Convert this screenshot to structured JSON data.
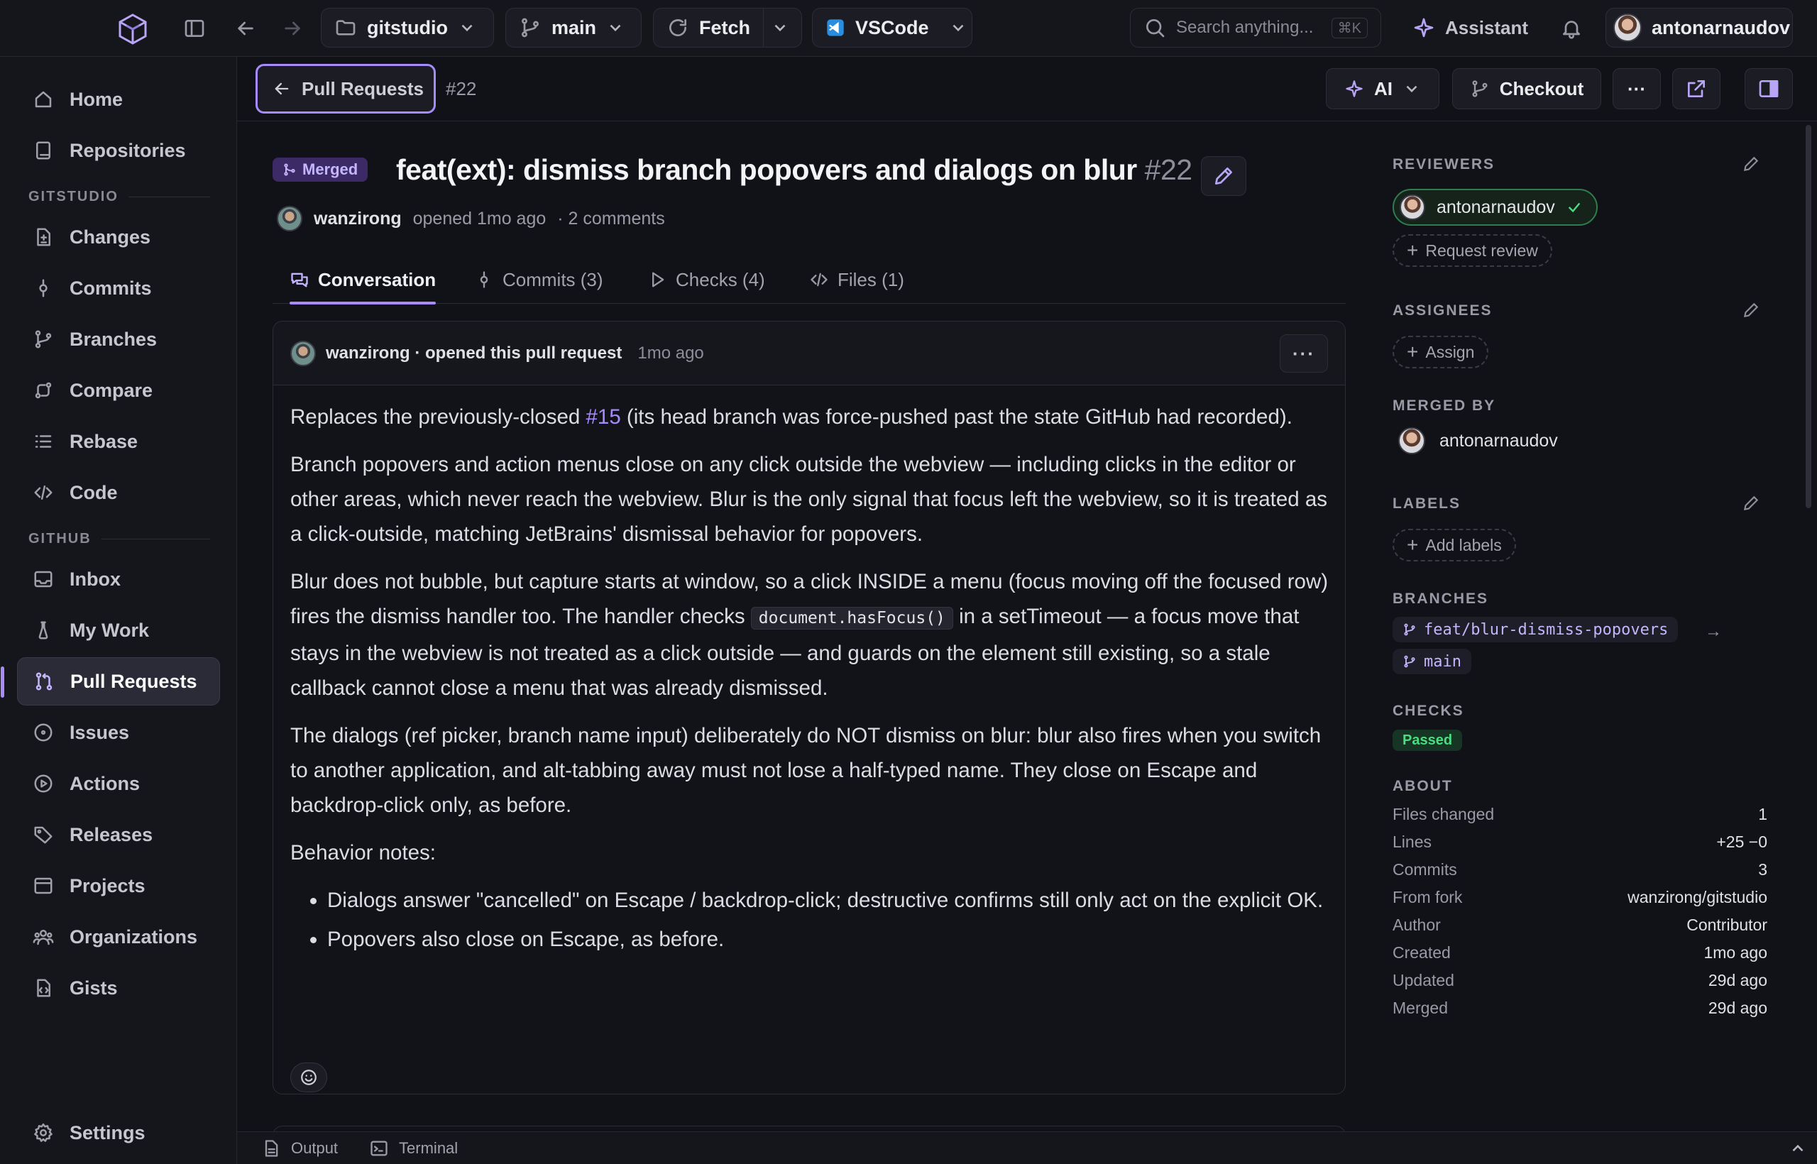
{
  "topbar": {
    "repo": "gitstudio",
    "branch": "main",
    "fetch_label": "Fetch",
    "editor_label": "VSCode",
    "search_placeholder": "Search anything...",
    "search_shortcut": "⌘K",
    "assistant_label": "Assistant",
    "username": "antonarnaudov"
  },
  "sidebar": {
    "top_items": [
      {
        "label": "Home",
        "icon": "home-icon"
      },
      {
        "label": "Repositories",
        "icon": "book-icon"
      }
    ],
    "section_gitstudio": "GITSTUDIO",
    "gitstudio_items": [
      {
        "label": "Changes",
        "icon": "diff-icon"
      },
      {
        "label": "Commits",
        "icon": "commit-icon"
      },
      {
        "label": "Branches",
        "icon": "branch-icon"
      },
      {
        "label": "Compare",
        "icon": "compare-icon"
      },
      {
        "label": "Rebase",
        "icon": "list-icon"
      },
      {
        "label": "Code",
        "icon": "code-icon"
      }
    ],
    "section_github": "GITHUB",
    "github_items": [
      {
        "label": "Inbox",
        "icon": "inbox-icon"
      },
      {
        "label": "My Work",
        "icon": "flask-icon"
      },
      {
        "label": "Pull Requests",
        "icon": "pull-request-icon",
        "active": true
      },
      {
        "label": "Issues",
        "icon": "issue-icon"
      },
      {
        "label": "Actions",
        "icon": "play-icon"
      },
      {
        "label": "Releases",
        "icon": "tag-icon"
      },
      {
        "label": "Projects",
        "icon": "project-icon"
      },
      {
        "label": "Organizations",
        "icon": "people-icon"
      },
      {
        "label": "Gists",
        "icon": "gist-icon"
      }
    ],
    "settings_label": "Settings"
  },
  "header": {
    "back_label": "Pull Requests",
    "pr_ref": "#22",
    "ai_label": "AI",
    "checkout_label": "Checkout",
    "more_label": "···"
  },
  "pr": {
    "status": "Merged",
    "title": "feat(ext): dismiss branch popovers and dialogs on blur",
    "number": "#22",
    "author": "wanzirong",
    "opened": "opened 1mo ago",
    "comments": "· 2 comments"
  },
  "tabs": [
    {
      "label": "Conversation",
      "icon": "comment-icon",
      "active": true
    },
    {
      "label": "Commits (3)",
      "icon": "commit-icon"
    },
    {
      "label": "Checks (4)",
      "icon": "play-icon"
    },
    {
      "label": "Files (1)",
      "icon": "code-icon"
    }
  ],
  "comment": {
    "header": "wanzirong · opened this pull request",
    "time": "1mo ago",
    "more": "···",
    "p1_before": "Replaces the previously-closed ",
    "p1_link": "#15",
    "p1_after": " (its head branch was force-pushed past the state GitHub had recorded).",
    "p2": "Branch popovers and action menus close on any click outside the webview — including clicks in the editor or other areas, which never reach the webview. Blur is the only signal that focus left the webview, so it is treated as a click-outside, matching JetBrains' dismissal behavior for popovers.",
    "p3_before": "Blur does not bubble, but capture starts at window, so a click INSIDE a menu (focus moving off the focused row) fires the dismiss handler too. The handler checks ",
    "p3_code": "document.hasFocus()",
    "p3_after": " in a setTimeout — a focus move that stays in the webview is not treated as a click outside — and guards on the element still existing, so a stale callback cannot close a menu that was already dismissed.",
    "p4": "The dialogs (ref picker, branch name input) deliberately do NOT dismiss on blur: blur also fires when you switch to another application, and alt-tabbing away must not lose a half-typed name. They close on Escape and backdrop-click only, as before.",
    "p5": "Behavior notes:",
    "bullets": [
      "Dialogs answer \"cancelled\" on Escape / backdrop-click; destructive confirms still only act on the explicit OK.",
      "Popovers also close on Escape, as before."
    ]
  },
  "right_panel": {
    "reviewers_label": "REVIEWERS",
    "reviewer": "antonarnaudov",
    "request_review": "Request review",
    "assignees_label": "ASSIGNEES",
    "assign": "Assign",
    "merged_by_label": "MERGED BY",
    "merged_by": "antonarnaudov",
    "labels_label": "LABELS",
    "add_labels": "Add labels",
    "branches_label": "BRANCHES",
    "head_branch": "feat/blur-dismiss-popovers",
    "base_branch": "main",
    "checks_label": "CHECKS",
    "checks_status": "Passed",
    "about_label": "ABOUT",
    "about": [
      {
        "k": "Files changed",
        "v": "1"
      },
      {
        "k": "Lines",
        "v": "+25 −0"
      },
      {
        "k": "Commits",
        "v": "3"
      },
      {
        "k": "From fork",
        "v": "wanzirong/gitstudio"
      },
      {
        "k": "Author",
        "v": "Contributor"
      },
      {
        "k": "Created",
        "v": "1mo ago"
      },
      {
        "k": "Updated",
        "v": "29d ago"
      },
      {
        "k": "Merged",
        "v": "29d ago"
      }
    ]
  },
  "bottombar": {
    "output": "Output",
    "terminal": "Terminal"
  },
  "colors": {
    "accent": "#a78bfa",
    "success": "#4ade80",
    "background": "#111218"
  }
}
